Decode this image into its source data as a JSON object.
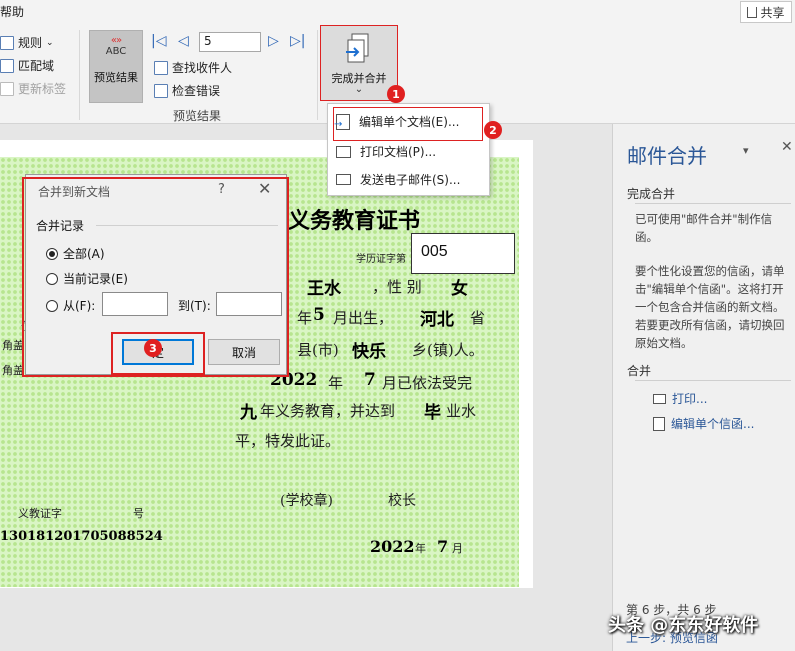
{
  "ribbon": {
    "tab_partial": "帮助",
    "share_label": "共享",
    "left_group": {
      "rules": "规则",
      "match_fields": "匹配域",
      "update_labels": "更新标签"
    },
    "preview_results": "预览结果",
    "preview_icon_text": "ABC",
    "record_number": "5",
    "find_recipient": "查找收件人",
    "check_errors": "检查错误",
    "group_preview_results": "预览结果",
    "finish_merge": "完成并合并",
    "finish_chevron": "⌄"
  },
  "menu": {
    "items": [
      {
        "label": "编辑单个文档(E)..."
      },
      {
        "label": "打印文档(P)..."
      },
      {
        "label": "发送电子邮件(S)..."
      }
    ]
  },
  "badges": [
    "1",
    "2",
    "3"
  ],
  "document": {
    "title_partial": "义务教育证书",
    "cert_number_label": "学历证字第",
    "serial": "005",
    "line1": {
      "name": "王水",
      "gender_label": "，性 别",
      "gender": "女"
    },
    "line2": {
      "prefix": "年",
      "month": "5",
      "mid": "月出生，",
      "province": "河北",
      "suffix": "省"
    },
    "line3": {
      "prefix": "县(市)",
      "town": "快乐",
      "suffix": "乡(镇)人。"
    },
    "line4": {
      "year": "2022",
      "year_label": "年",
      "month": "7",
      "suffix": "月已依法受完"
    },
    "line5": {
      "grade": "九",
      "mid": "年义务教育，并达到",
      "status": "毕",
      "suffix": "业水"
    },
    "line6": "平，特发此证。",
    "seal": "(学校章)",
    "principal": "校长",
    "cert_word_left": "义教证字",
    "cert_word_right": "号",
    "id_number": "130181201705088524",
    "date_year": "2022",
    "date_year_label": "年",
    "date_month": "7",
    "date_month_label": "月",
    "left_fragments": [
      "角盖",
      "角盖",
      "住"
    ]
  },
  "dialog": {
    "title": "合并到新文档",
    "help": "?",
    "close": "✕",
    "group_label": "合并记录",
    "opt_all": "全部(A)",
    "opt_current": "当前记录(E)",
    "opt_from": "从(F):",
    "to_label": "到(T):",
    "ok_label": "确定",
    "ok_visible": "定",
    "cancel_label": "取消"
  },
  "pane": {
    "title": "邮件合并",
    "menu_icon": "▾",
    "close": "✕",
    "section1": "完成合并",
    "para1": "已可使用\"邮件合并\"制作信函。",
    "para2": "要个性化设置您的信函，请单击\"编辑单个信函\"。这将打开一个包含合并信函的新文档。若要更改所有信函，请切换回原始文档。",
    "section2": "合并",
    "link_print": "打印...",
    "link_edit": "编辑单个信函...",
    "step": "第 6 步，共 6 步",
    "prev_step": "上一步: 预览信函"
  },
  "watermark": "头条 @东东好软件",
  "colors": {
    "accent_red": "#d22222",
    "link_blue": "#2b5797",
    "certificate_green": "#d9f5c4"
  }
}
